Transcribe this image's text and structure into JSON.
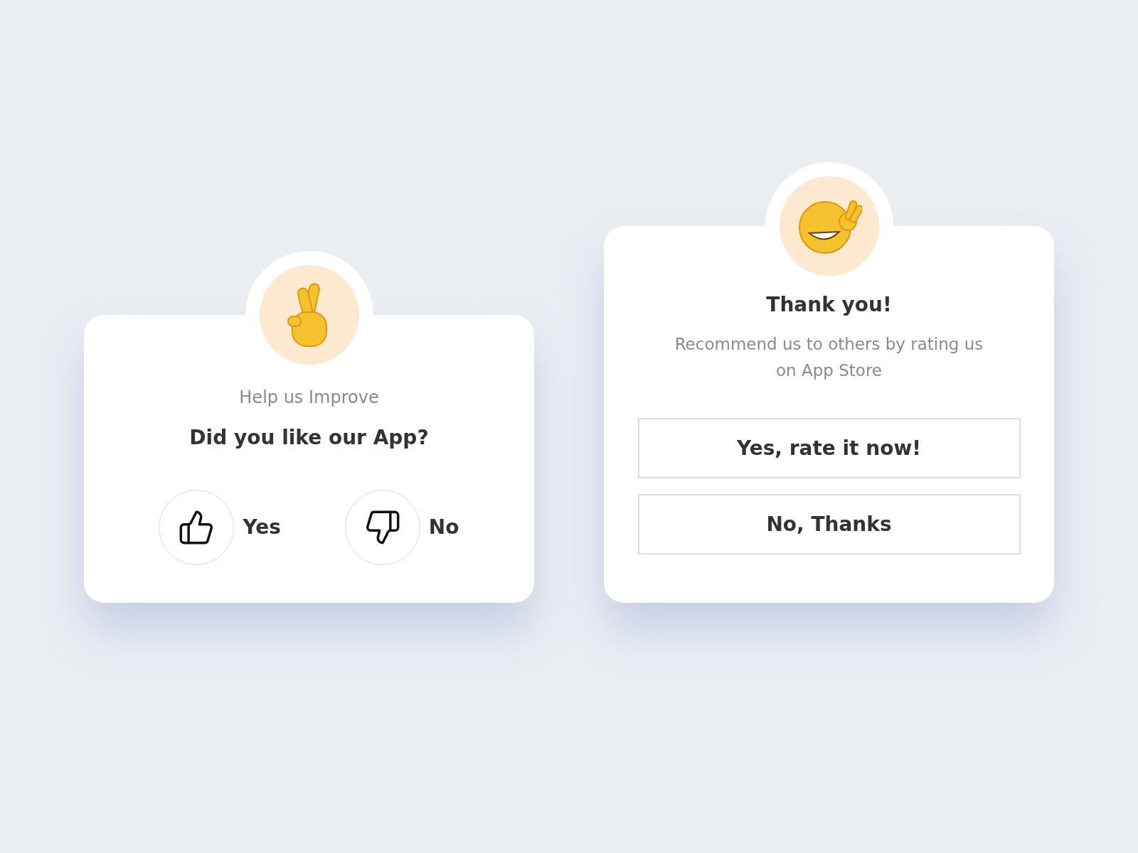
{
  "feedback_card": {
    "eyebrow": "Help us Improve",
    "question": "Did you like our App?",
    "options": [
      {
        "label": "Yes",
        "kind": "up"
      },
      {
        "label": "No",
        "kind": "down"
      }
    ]
  },
  "thanks_card": {
    "title": "Thank you!",
    "message": "Recommend us to others by rating us on App Store",
    "buttons": [
      "Yes, rate it now!",
      "No, Thanks"
    ]
  }
}
